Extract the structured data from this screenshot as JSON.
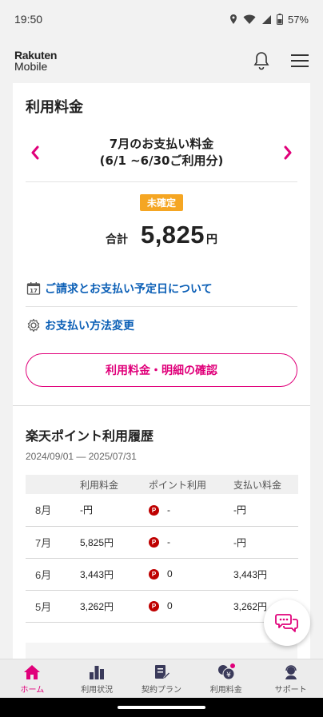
{
  "status": {
    "time": "19:50",
    "battery": "57%"
  },
  "header": {
    "logo_line1": "Rakuten",
    "logo_line2": "Mobile"
  },
  "billing": {
    "section_title": "利用料金",
    "month_title_line1": "7月のお支払い料金",
    "month_title_line2": "(6/1 ~6/30ご利用分)",
    "badge": "未確定",
    "total_label": "合計",
    "total_amount": "5,825",
    "total_unit": "円",
    "link_schedule": "ご請求とお支払い予定日について",
    "link_payment": "お支払い方法変更",
    "details_button": "利用料金・明細の確認",
    "accent_color": "#e0007a",
    "badge_color": "#f5a623"
  },
  "points": {
    "title": "楽天ポイント利用履歴",
    "date_range": "2024/09/01 — 2025/07/31",
    "columns": [
      "",
      "利用料金",
      "ポイント利用",
      "支払い料金"
    ],
    "rows": [
      {
        "month": "8月",
        "fee": "-円",
        "point_icon": "P",
        "points": "-",
        "paid": "-円"
      },
      {
        "month": "7月",
        "fee": "5,825円",
        "point_icon": "P",
        "points": "-",
        "paid": "-円"
      },
      {
        "month": "6月",
        "fee": "3,443円",
        "point_icon": "P",
        "points": "0",
        "paid": "3,443円"
      },
      {
        "month": "5月",
        "fee": "3,262円",
        "point_icon": "P",
        "points": "0",
        "paid": "3,262円"
      }
    ]
  },
  "tabs": [
    {
      "label": "ホーム",
      "icon": "home-icon",
      "active": true
    },
    {
      "label": "利用状況",
      "icon": "bar-chart-icon",
      "active": false
    },
    {
      "label": "契約プラン",
      "icon": "contract-icon",
      "active": false
    },
    {
      "label": "利用料金",
      "icon": "yen-fee-icon",
      "active": false
    },
    {
      "label": "サポート",
      "icon": "support-icon",
      "active": false
    }
  ]
}
